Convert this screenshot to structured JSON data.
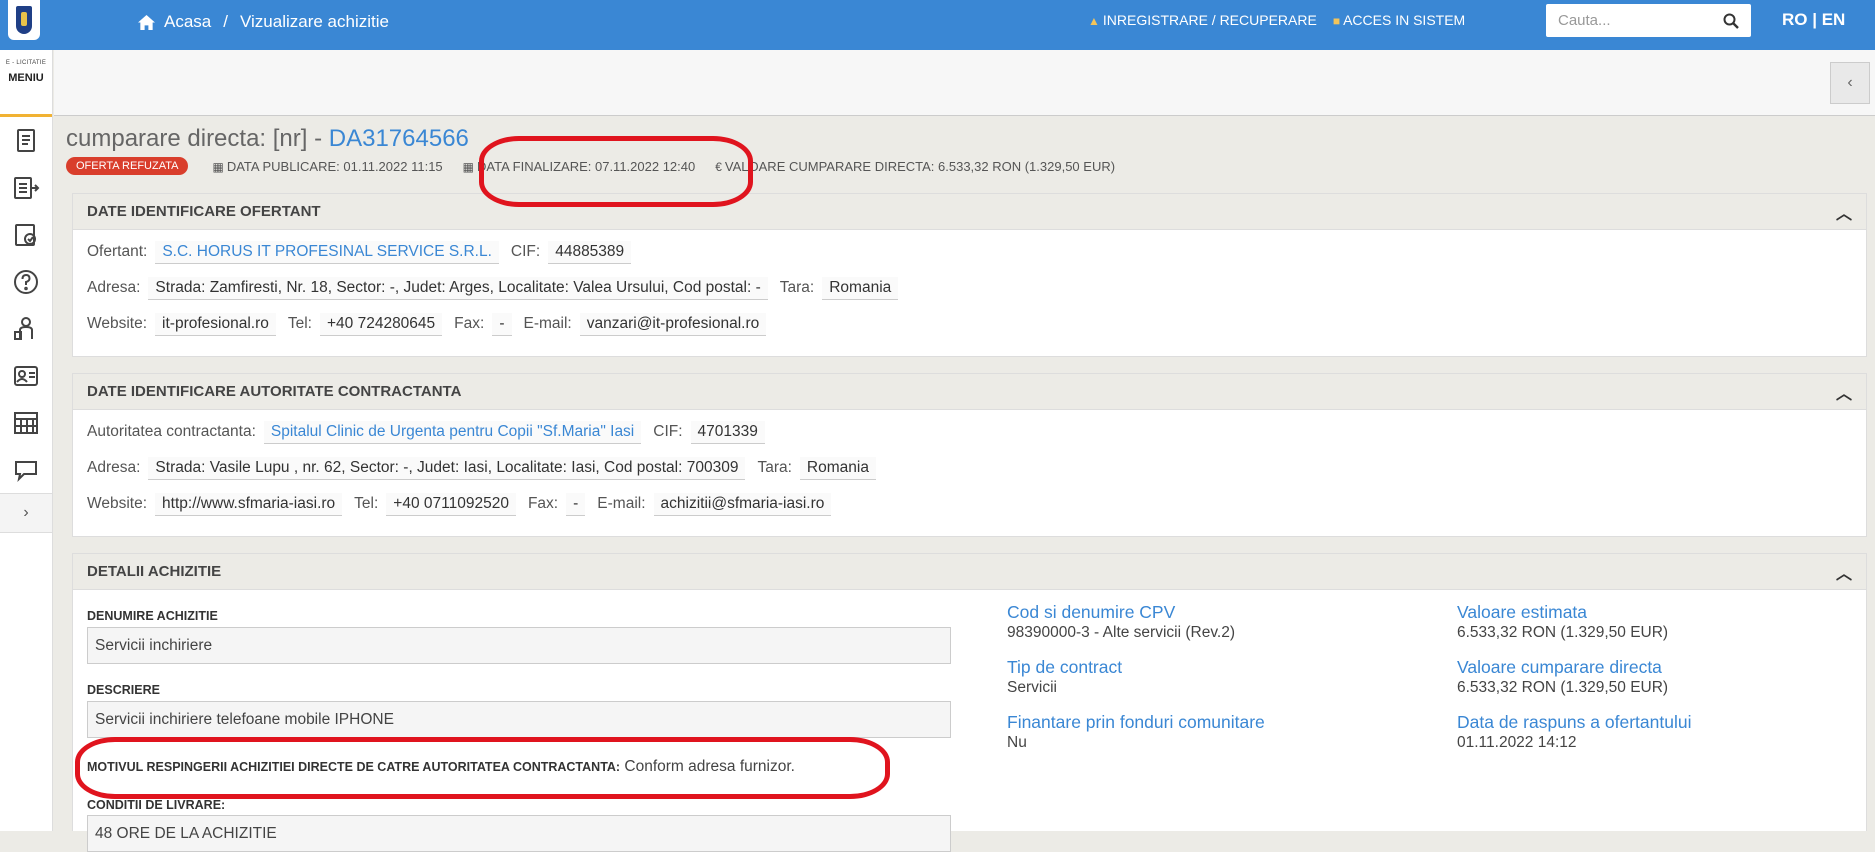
{
  "header": {
    "breadcrumb_home": "Acasa",
    "breadcrumb_sep": "/",
    "breadcrumb_current": "Vizualizare achizitie",
    "register_link": "INREGISTRARE / RECUPERARE",
    "login_link": "ACCES IN SISTEM",
    "search_placeholder": "Cauta...",
    "lang": "RO | EN"
  },
  "sidebar": {
    "brand_small": "E - LICITATIE",
    "menu_label": "MENIU",
    "icons": [
      "document-icon",
      "list-arrow-icon",
      "checklist-icon",
      "help-icon",
      "person-icon",
      "id-card-icon",
      "calendar-grid-icon",
      "chat-icon"
    ],
    "more": "›"
  },
  "subheader": {
    "collapse": "‹"
  },
  "procurement": {
    "title_prefix": "cumparare directa: [nr] -",
    "code": "DA31764566",
    "status_badge": "OFERTA REFUZATA",
    "publish_date": "DATA PUBLICARE: 01.11.2022 11:15",
    "final_date": "DATA FINALIZARE: 07.11.2022 12:40",
    "value": "VALOARE CUMPARARE DIRECTA: 6.533,32  RON (1.329,50  EUR)"
  },
  "bidder": {
    "heading": "DATE IDENTIFICARE OFERTANT",
    "name_label": "Ofertant:",
    "name": "S.C. HORUS IT PROFESINAL SERVICE S.R.L.",
    "cif_label": "CIF:",
    "cif": "44885389",
    "address_label": "Adresa:",
    "address": "Strada: Zamfiresti, Nr. 18, Sector: -, Judet: Arges, Localitate: Valea Ursului, Cod postal: -",
    "country_label": "Tara:",
    "country": "Romania",
    "website_label": "Website:",
    "website": "it-profesional.ro",
    "tel_label": "Tel:",
    "tel": "+40 724280645",
    "fax_label": "Fax:",
    "fax": "-",
    "email_label": "E-mail:",
    "email": "vanzari@it-profesional.ro"
  },
  "authority": {
    "heading": "DATE IDENTIFICARE AUTORITATE CONTRACTANTA",
    "name_label": "Autoritatea contractanta:",
    "name": "Spitalul Clinic de Urgenta pentru Copii \"Sf.Maria\" Iasi",
    "cif_label": "CIF:",
    "cif": "4701339",
    "address_label": "Adresa:",
    "address": "Strada: Vasile Lupu , nr. 62, Sector: -, Judet: Iasi, Localitate: Iasi, Cod postal: 700309",
    "country_label": "Tara:",
    "country": "Romania",
    "website_label": "Website:",
    "website": "http://www.sfmaria-iasi.ro",
    "tel_label": "Tel:",
    "tel": "+40 0711092520",
    "fax_label": "Fax:",
    "fax": "-",
    "email_label": "E-mail:",
    "email": "achizitii@sfmaria-iasi.ro"
  },
  "details": {
    "heading": "DETALII ACHIZITIE",
    "name_label": "DENUMIRE ACHIZITIE",
    "name": "Servicii inchiriere",
    "desc_label": "DESCRIERE",
    "desc": "Servicii inchiriere telefoane mobile IPHONE",
    "reject_label": "MOTIVUL RESPINGERII ACHIZITIEI DIRECTE DE CATRE AUTORITATEA CONTRACTANTA:",
    "reject_reason": "Conform adresa furnizor.",
    "delivery_label": "CONDITII DE LIVRARE:",
    "delivery": "48 ORE DE LA ACHIZITIE",
    "cpv_label": "Cod si denumire CPV",
    "cpv": "98390000-3 - Alte servicii (Rev.2)",
    "contract_type_label": "Tip de contract",
    "contract_type": "Servicii",
    "eu_funds_label": "Finantare prin fonduri comunitare",
    "eu_funds": "Nu",
    "estimated_label": "Valoare estimata",
    "estimated": "6.533,32  RON (1.329,50  EUR)",
    "direct_value_label": "Valoare cumparare directa",
    "direct_value": "6.533,32  RON (1.329,50  EUR)",
    "response_date_label": "Data de raspuns a ofertantului",
    "response_date": "01.11.2022 14:12"
  }
}
